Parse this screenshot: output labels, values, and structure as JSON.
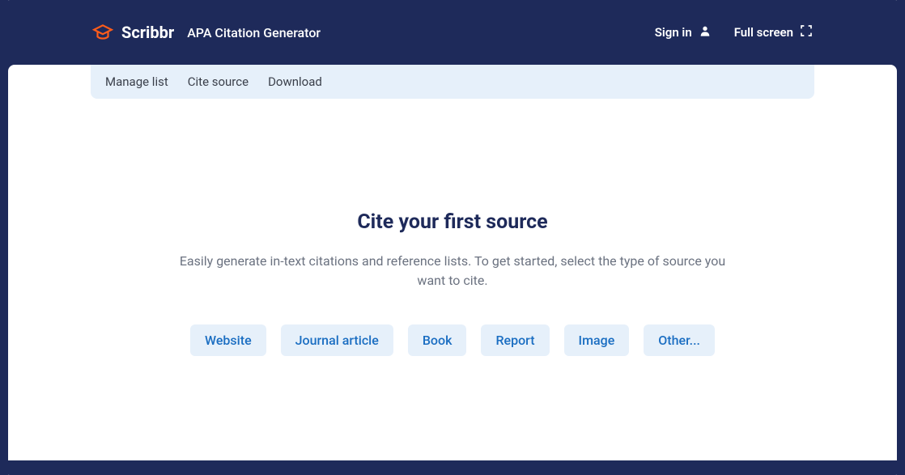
{
  "brand": {
    "name": "Scribbr"
  },
  "app_title": "APA Citation Generator",
  "header": {
    "sign_in": "Sign in",
    "full_screen": "Full screen"
  },
  "tabs": {
    "manage": "Manage list",
    "cite": "Cite source",
    "download": "Download"
  },
  "main": {
    "headline": "Cite your first source",
    "subtext": "Easily generate in-text citations and reference lists. To get started, select the type of source you want to cite."
  },
  "source_types": {
    "website": "Website",
    "journal": "Journal article",
    "book": "Book",
    "report": "Report",
    "image": "Image",
    "other": "Other..."
  }
}
